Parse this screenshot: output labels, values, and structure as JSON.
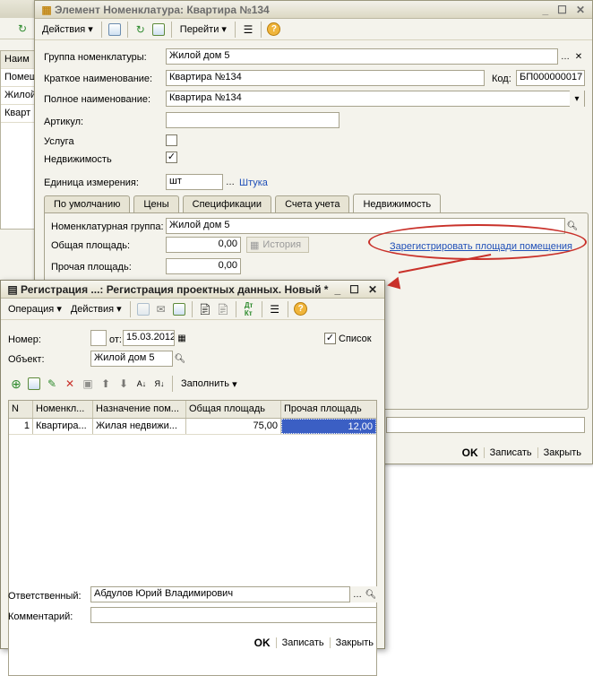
{
  "background": {
    "grid_header": "Наим",
    "rows": [
      "Помещ",
      "Жилой",
      "Кварт"
    ]
  },
  "main_window": {
    "title": "Элемент Номенклатура: Квартира №134",
    "toolbar": {
      "actions": "Действия",
      "goto": "Перейти"
    },
    "fields": {
      "group_label": "Группа номенклатуры:",
      "group_value": "Жилой дом 5",
      "short_name_label": "Краткое наименование:",
      "short_name_value": "Квартира №134",
      "code_label": "Код:",
      "code_value": "БП000000017",
      "full_name_label": "Полное наименование:",
      "full_name_value": "Квартира №134",
      "article_label": "Артикул:",
      "article_value": "",
      "service_label": "Услуга",
      "realty_label": "Недвижимость",
      "unit_label": "Единица измерения:",
      "unit_value": "шт",
      "unit_link": "Штука"
    },
    "tabs": [
      "По умолчанию",
      "Цены",
      "Спецификации",
      "Счета учета",
      "Недвижимость"
    ],
    "realty_tab": {
      "group_label": "Номенклатурная группа:",
      "group_value": "Жилой дом 5",
      "total_area_label": "Общая площадь:",
      "total_area_value": "0,00",
      "history_button": "История",
      "register_link": "Зарегистрировать площади помещения",
      "other_area_label": "Прочая площадь:",
      "other_area_value": "0,00"
    },
    "footer": {
      "ok": "OK",
      "save": "Записать",
      "close": "Закрыть"
    }
  },
  "reg_window": {
    "title": "Регистрация ...: Регистрация проектных данных. Новый *",
    "toolbar": {
      "operation": "Операция",
      "actions": "Действия"
    },
    "number_label": "Номер:",
    "number_value": "",
    "from_label": "от:",
    "date_value": "15.03.2012",
    "list_label": "Список",
    "object_label": "Объект:",
    "object_value": "Жилой дом 5",
    "fill_label": "Заполнить",
    "table": {
      "columns": [
        "N",
        "Номенкл...",
        "Назначение пом...",
        "Общая площадь",
        "Прочая площадь"
      ],
      "rows": [
        {
          "n": "1",
          "item": "Квартира...",
          "purpose": "Жилая недвижи...",
          "total": "75,00",
          "other": "12,00"
        }
      ]
    },
    "responsible_label": "Ответственный:",
    "responsible_value": "Абдулов Юрий Владимирович",
    "comment_label": "Комментарий:",
    "comment_value": "",
    "footer": {
      "ok": "OK",
      "save": "Записать",
      "close": "Закрыть"
    }
  },
  "colors": {
    "annotation": "#c9312a",
    "link": "#1f4fb8",
    "selection": "#3b5fc4"
  }
}
